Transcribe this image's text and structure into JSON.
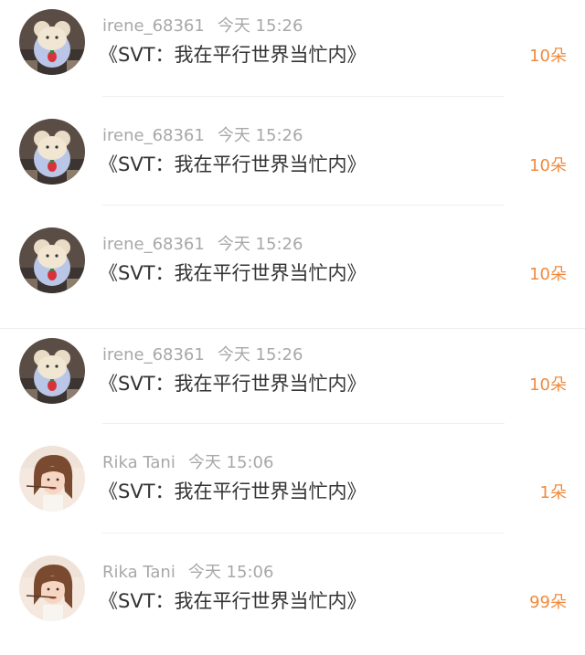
{
  "items": [
    {
      "user": "irene_68361",
      "time": "今天 15:26",
      "title": "《SVT：我在平行世界当忙内》",
      "gift": "10朵",
      "avatar": "bear-avatar-icon"
    },
    {
      "user": "irene_68361",
      "time": "今天 15:26",
      "title": "《SVT：我在平行世界当忙内》",
      "gift": "10朵",
      "avatar": "bear-avatar-icon"
    },
    {
      "user": "irene_68361",
      "time": "今天 15:26",
      "title": "《SVT：我在平行世界当忙内》",
      "gift": "10朵",
      "avatar": "bear-avatar-icon"
    },
    {
      "user": "irene_68361",
      "time": "今天 15:26",
      "title": "《SVT：我在平行世界当忙内》",
      "gift": "10朵",
      "avatar": "bear-avatar-icon"
    },
    {
      "user": "Rika Tani",
      "time": "今天 15:06",
      "title": "《SVT：我在平行世界当忙内》",
      "gift": "1朵",
      "avatar": "girl-avatar-icon"
    },
    {
      "user": "Rika Tani",
      "time": "今天 15:06",
      "title": "《SVT：我在平行世界当忙内》",
      "gift": "99朵",
      "avatar": "girl-avatar-icon"
    }
  ],
  "colors": {
    "gift": "#f08a3e",
    "meta": "#a8a8a8",
    "title": "#333333"
  }
}
